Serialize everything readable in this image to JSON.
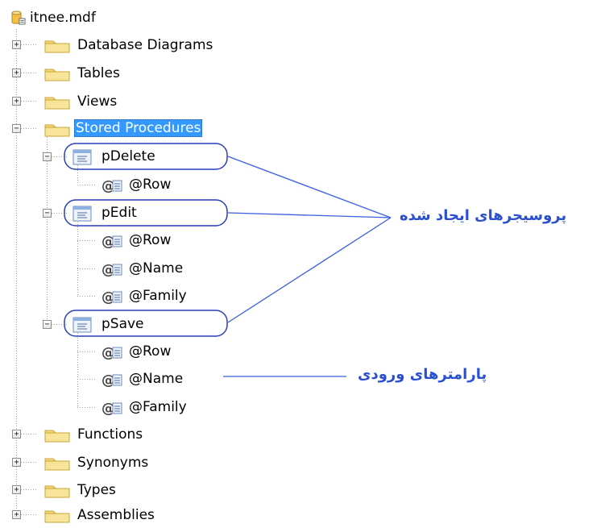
{
  "root": {
    "label": "itnee.mdf",
    "icon": "database-file-icon"
  },
  "nodes": {
    "database_diagrams": "Database Diagrams",
    "tables": "Tables",
    "views": "Views",
    "stored_procedures": "Stored Procedures",
    "functions": "Functions",
    "synonyms": "Synonyms",
    "types": "Types",
    "assemblies": "Assemblies"
  },
  "procedures": [
    {
      "name": "pDelete",
      "params": [
        "@Row"
      ]
    },
    {
      "name": "pEdit",
      "params": [
        "@Row",
        "@Name",
        "@Family"
      ]
    },
    {
      "name": "pSave",
      "params": [
        "@Row",
        "@Name",
        "@Family"
      ]
    }
  ],
  "expander": {
    "collapsed": "+",
    "expanded": "−"
  },
  "annotations": {
    "created_procedures": "پروسیجرهای ایجاد شده",
    "input_parameters": "پارامترهای ورودی"
  },
  "colors": {
    "selection": "#3399ff",
    "annotation": "#2a4fd0",
    "folder": "#f5d97a",
    "tree_line": "#a0a0a0"
  }
}
